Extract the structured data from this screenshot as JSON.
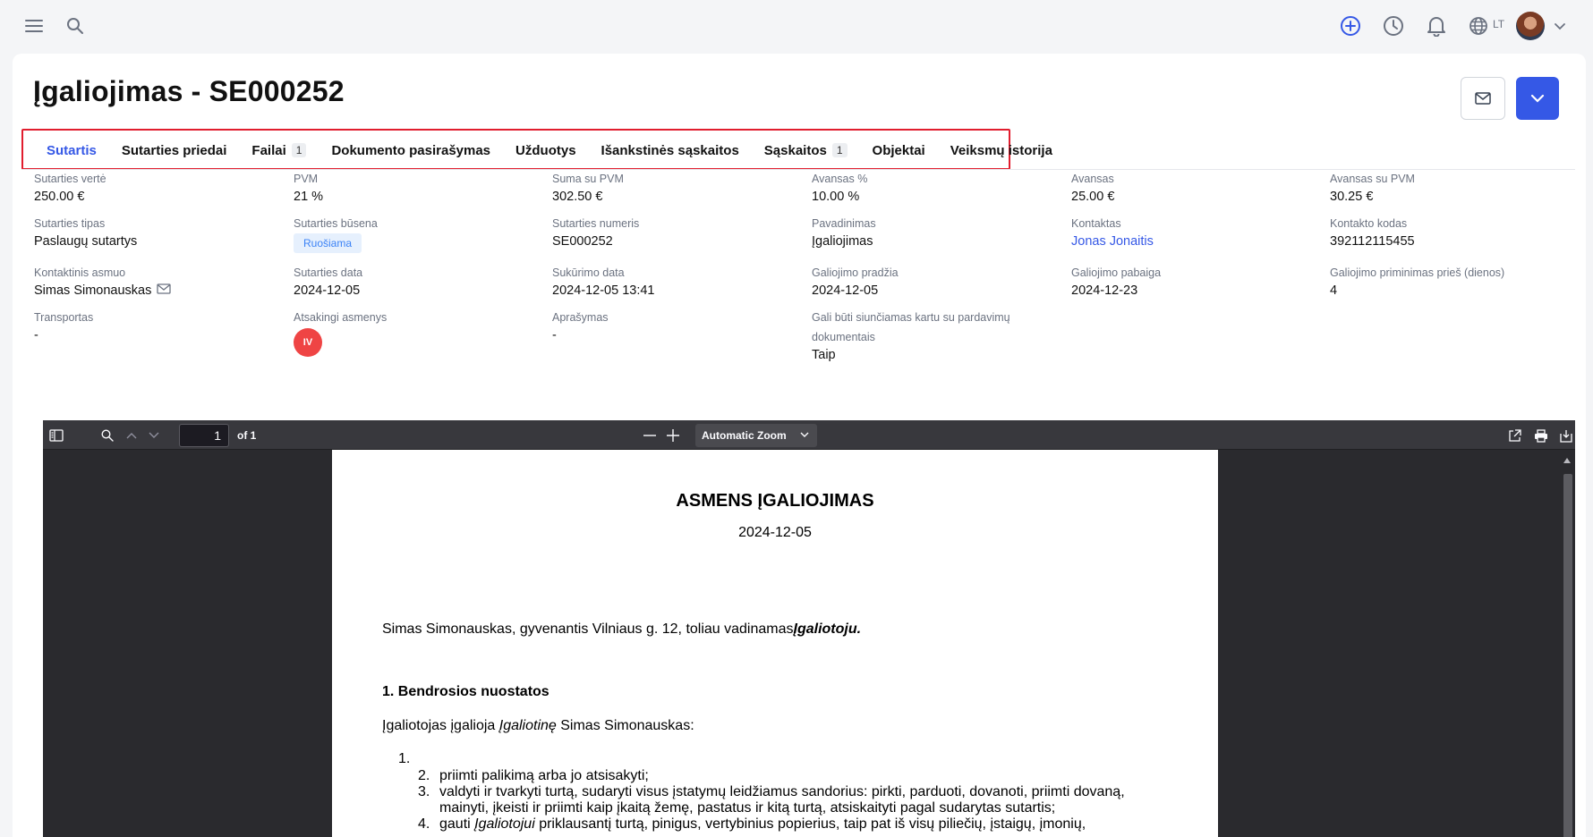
{
  "topbar": {
    "menu_icon": "hamburger-menu-icon",
    "search_icon": "search-icon",
    "add_icon": "plus-circle-icon",
    "history_icon": "clock-icon",
    "notifications_icon": "bell-icon",
    "language_icon": "globe-icon",
    "language": "LT",
    "avatar_icon": "user-avatar"
  },
  "page": {
    "title": "Įgaliojimas - SE000252"
  },
  "tabs": [
    {
      "label": "Sutartis",
      "active": true,
      "badge": ""
    },
    {
      "label": "Sutarties priedai",
      "badge": ""
    },
    {
      "label": "Failai",
      "badge": "1"
    },
    {
      "label": "Dokumento pasirašymas",
      "badge": ""
    },
    {
      "label": "Užduotys",
      "badge": ""
    },
    {
      "label": "Išankstinės sąskaitos",
      "badge": ""
    },
    {
      "label": "Sąskaitos",
      "badge": "1"
    },
    {
      "label": "Objektai",
      "badge": ""
    },
    {
      "label": "Veiksmų istorija",
      "badge": ""
    }
  ],
  "fields": {
    "contract_value": {
      "label": "Sutarties vertė",
      "value": "250.00 €"
    },
    "vat": {
      "label": "PVM",
      "value": "21 %"
    },
    "sum_with_vat": {
      "label": "Suma su PVM",
      "value": "302.50 €"
    },
    "advance_pct": {
      "label": "Avansas %",
      "value": "10.00 %"
    },
    "advance": {
      "label": "Avansas",
      "value": "25.00 €"
    },
    "advance_with_vat": {
      "label": "Avansas su PVM",
      "value": "30.25 €"
    },
    "contract_type": {
      "label": "Sutarties tipas",
      "value": "Paslaugų sutartys"
    },
    "contract_status": {
      "label": "Sutarties būsena",
      "value": "Ruošiama"
    },
    "contract_number": {
      "label": "Sutarties numeris",
      "value": "SE000252"
    },
    "name": {
      "label": "Pavadinimas",
      "value": "Įgaliojimas"
    },
    "contact": {
      "label": "Kontaktas",
      "value": "Jonas Jonaitis"
    },
    "contact_code": {
      "label": "Kontakto kodas",
      "value": "392112115455"
    },
    "contact_person": {
      "label": "Kontaktinis asmuo",
      "value": "Simas Simonauskas"
    },
    "contract_date": {
      "label": "Sutarties data",
      "value": "2024-12-05"
    },
    "created_date": {
      "label": "Sukūrimo data",
      "value": "2024-12-05 13:41"
    },
    "valid_from": {
      "label": "Galiojimo pradžia",
      "value": "2024-12-05"
    },
    "valid_to": {
      "label": "Galiojimo pabaiga",
      "value": "2024-12-23"
    },
    "reminder": {
      "label": "Galiojimo priminimas prieš (dienos)",
      "value": "4"
    },
    "transport": {
      "label": "Transportas",
      "value": "-"
    },
    "responsible": {
      "label": "Atsakingi asmenys",
      "value": "IV"
    },
    "description": {
      "label": "Aprašymas",
      "value": "-"
    },
    "send_with_sales": {
      "label_line1": "Gali būti siunčiamas kartu su pardavimų",
      "label_line2": "dokumentais",
      "value": "Taip"
    }
  },
  "viewer": {
    "page_number": "1",
    "page_of": "of 1",
    "zoom": "Automatic Zoom"
  },
  "document": {
    "title": "ASMENS ĮGALIOJIMAS",
    "date": "2024-12-05",
    "para_prefix": "Simas Simonauskas,  gyvenantis Vilniaus g. 12, toliau vadinamas",
    "para_emph": "Įgaliotoju.",
    "section_heading": "1. Bendrosios nuostatos",
    "intro_a": "Įgaliotojas įgalioja ",
    "intro_emph": "Įgaliotinę",
    "intro_b": " Simas Simonauskas:",
    "n1": "1.",
    "list": [
      {
        "num": "2.",
        "text": "priimti palikimą arba jo atsisakyti;"
      },
      {
        "num": "3.",
        "text": "valdyti ir tvarkyti turtą, sudaryti visus įstatymų leidžiamus sandorius: pirkti, parduoti, dovanoti, priimti dovaną, mainyti, įkeisti ir priimti kaip įkaitą žemę, pastatus ir kitą turtą, atsiskaityti pagal sudarytas sutartis;"
      },
      {
        "num": "4.",
        "text_a": "gauti ",
        "text_emph": "Įgaliotojui",
        "text_b": " priklausantį turtą, pinigus, vertybinius popierius, taip pat iš visų piliečių, įstaigų, įmonių,"
      }
    ]
  }
}
